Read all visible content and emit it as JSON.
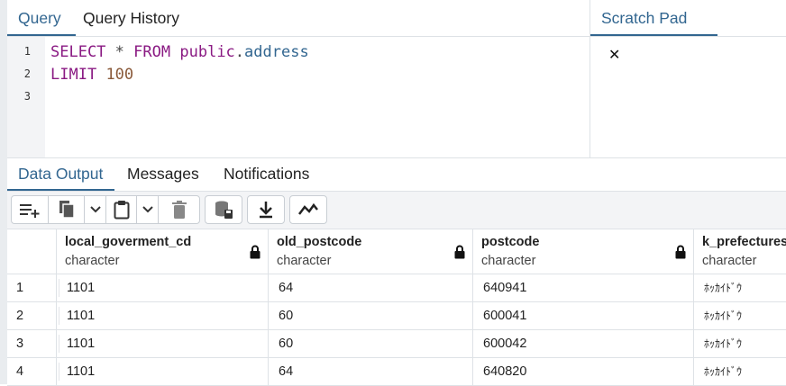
{
  "query_tabs": [
    {
      "label": "Query",
      "active": true
    },
    {
      "label": "Query History",
      "active": false
    }
  ],
  "scratch_pad": {
    "label": "Scratch Pad",
    "close": "✕"
  },
  "editor": {
    "line_numbers": [
      "1",
      "2",
      "3"
    ],
    "line1": {
      "select": "SELECT",
      "star": "*",
      "from": "FROM",
      "schema": "public",
      "dot": ".",
      "table": "address"
    },
    "line2": {
      "limit": "LIMIT",
      "value": "100"
    }
  },
  "output_tabs": [
    {
      "label": "Data Output",
      "active": true
    },
    {
      "label": "Messages",
      "active": false
    },
    {
      "label": "Notifications",
      "active": false
    }
  ],
  "toolbar": {
    "icons": [
      "add-row-icon",
      "copy-icon",
      "chevron-down-icon",
      "paste-icon",
      "chevron-down-icon",
      "delete-icon",
      "save-data-icon",
      "download-icon",
      "graph-icon"
    ]
  },
  "columns": [
    {
      "name": "local_goverment_cd",
      "type": "character",
      "locked": true
    },
    {
      "name": "old_postcode",
      "type": "character",
      "locked": true
    },
    {
      "name": "postcode",
      "type": "character",
      "locked": true
    },
    {
      "name": "k_prefectures",
      "type": "character",
      "locked": false
    }
  ],
  "rows": [
    {
      "index": "1",
      "cells": [
        "1101",
        "64",
        "640941",
        "ﾎｯｶｲﾄﾞｳ"
      ]
    },
    {
      "index": "2",
      "cells": [
        "1101",
        "60",
        "600041",
        "ﾎｯｶｲﾄﾞｳ"
      ]
    },
    {
      "index": "3",
      "cells": [
        "1101",
        "60",
        "600042",
        "ﾎｯｶｲﾄﾞｳ"
      ]
    },
    {
      "index": "4",
      "cells": [
        "1101",
        "64",
        "640820",
        "ﾎｯｶｲﾄﾞｳ"
      ]
    }
  ],
  "colors": {
    "accent": "#326690",
    "keyword": "#8a1a83",
    "number": "#8a5a3a"
  }
}
